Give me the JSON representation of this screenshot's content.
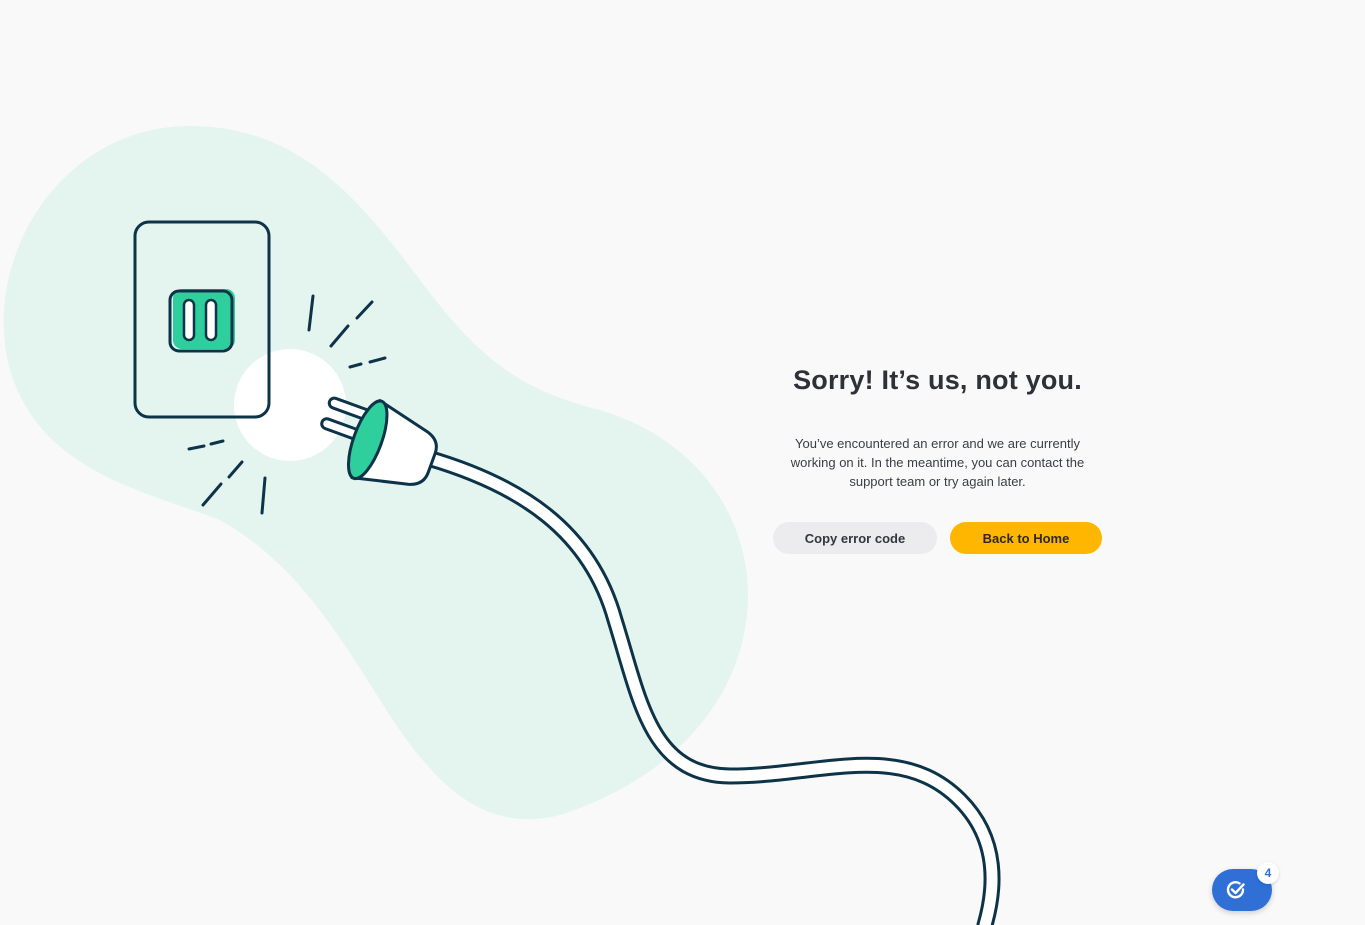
{
  "error": {
    "title": "Sorry! It’s us, not you.",
    "description": "You’ve encountered an error and we are currently working on it. In the meantime, you can contact the support team or try again later."
  },
  "actions": {
    "copy_label": "Copy error code",
    "home_label": "Back to Home"
  },
  "fab": {
    "icon": "check-circle-icon",
    "badge_count": "4"
  },
  "colors": {
    "background": "#f9f9f9",
    "blob": "#e4f5ef",
    "accent_green": "#2ecf9d",
    "outline": "#0d3349",
    "primary_button": "#ffb600",
    "fab_blue": "#2f6fd6"
  }
}
